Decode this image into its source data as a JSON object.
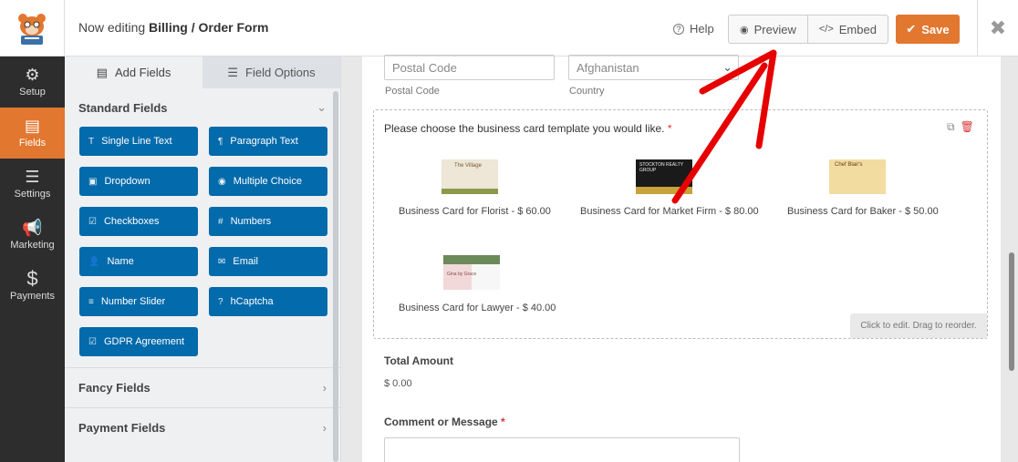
{
  "header": {
    "editing_prefix": "Now editing",
    "form_name": "Billing / Order Form",
    "help_label": "Help",
    "preview_label": "Preview",
    "embed_label": "Embed",
    "save_label": "Save"
  },
  "nav": {
    "items": [
      {
        "label": "Setup",
        "icon": "gear-icon"
      },
      {
        "label": "Fields",
        "icon": "list-icon",
        "active": true
      },
      {
        "label": "Settings",
        "icon": "sliders-icon"
      },
      {
        "label": "Marketing",
        "icon": "megaphone-icon"
      },
      {
        "label": "Payments",
        "icon": "dollar-icon"
      }
    ]
  },
  "panel": {
    "tab_add": "Add Fields",
    "tab_options": "Field Options",
    "standard_title": "Standard Fields",
    "fields": [
      {
        "label": "Single Line Text",
        "icon": "T"
      },
      {
        "label": "Paragraph Text",
        "icon": "¶"
      },
      {
        "label": "Dropdown",
        "icon": "▣"
      },
      {
        "label": "Multiple Choice",
        "icon": "◉"
      },
      {
        "label": "Checkboxes",
        "icon": "☑"
      },
      {
        "label": "Numbers",
        "icon": "#"
      },
      {
        "label": "Name",
        "icon": "👤"
      },
      {
        "label": "Email",
        "icon": "✉"
      },
      {
        "label": "Number Slider",
        "icon": "≡"
      },
      {
        "label": "hCaptcha",
        "icon": "?"
      },
      {
        "label": "GDPR Agreement",
        "icon": "☑"
      }
    ],
    "fancy_title": "Fancy Fields",
    "payment_title": "Payment Fields"
  },
  "form": {
    "postal_placeholder": "Postal Code",
    "postal_sublabel": "Postal Code",
    "country_value": "Afghanistan",
    "country_sublabel": "Country",
    "question": "Please choose the business card template you would like.",
    "required_mark": "*",
    "cards": [
      {
        "caption": "Business Card for Florist - $ 60.00",
        "img_text": "The Village"
      },
      {
        "caption": "Business Card for Market Firm - $ 80.00",
        "img_text": "STOCKTON REALTY GROUP"
      },
      {
        "caption": "Business Card for Baker - $ 50.00",
        "img_text": "Chef Blair's"
      },
      {
        "caption": "Business Card for Lawyer - $ 40.00",
        "img_text": "Gina by Grace"
      }
    ],
    "edit_hint": "Click to edit. Drag to reorder.",
    "total_label": "Total Amount",
    "total_value": "$ 0.00",
    "comment_label": "Comment or Message"
  },
  "colors": {
    "accent": "#e27730",
    "field_button": "#036aab",
    "nav_bg": "#2d2d2d"
  }
}
